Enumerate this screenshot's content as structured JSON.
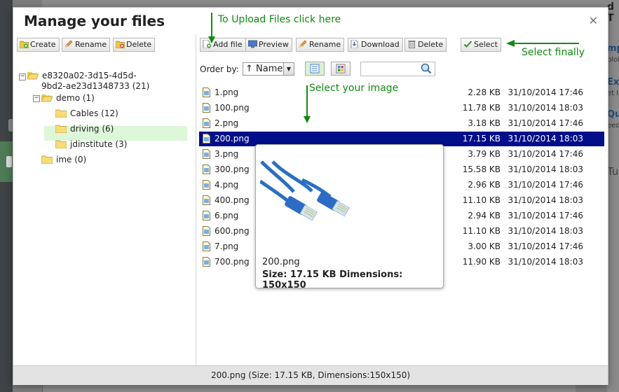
{
  "dialog": {
    "title": "Manage your files"
  },
  "left_toolbar": {
    "create": "Create",
    "rename": "Rename",
    "delete": "Delete"
  },
  "tree": {
    "root": "e8320a02-3d15-4d5d-",
    "root_line2": "9bd2-ae23d1348733 (21)",
    "demo": "demo (1)",
    "cables": "Cables (12)",
    "driving": "driving (6)",
    "jdinstitute": "jdinstitute (3)",
    "ime": "ime (0)"
  },
  "right_toolbar": {
    "add_file": "Add file",
    "preview": "Preview",
    "rename": "Rename",
    "download": "Download",
    "delete": "Delete",
    "select": "Select"
  },
  "order": {
    "label": "Order by:",
    "value": "↑ Name"
  },
  "files": [
    {
      "name": "1.png",
      "size": "2.28 KB",
      "date": "31/10/2014 17:46"
    },
    {
      "name": "100.png",
      "size": "11.78 KB",
      "date": "31/10/2014 18:03"
    },
    {
      "name": "2.png",
      "size": "3.18 KB",
      "date": "31/10/2014 17:46"
    },
    {
      "name": "200.png",
      "size": "17.15 KB",
      "date": "31/10/2014 18:03"
    },
    {
      "name": "3.png",
      "size": "3.79 KB",
      "date": "31/10/2014 17:46"
    },
    {
      "name": "300.png",
      "size": "15.58 KB",
      "date": "31/10/2014 18:03"
    },
    {
      "name": "4.png",
      "size": "2.96 KB",
      "date": "31/10/2014 17:46"
    },
    {
      "name": "400.png",
      "size": "11.10 KB",
      "date": "31/10/2014 18:03"
    },
    {
      "name": "6.png",
      "size": "2.94 KB",
      "date": "31/10/2014 17:46"
    },
    {
      "name": "600.png",
      "size": "11.10 KB",
      "date": "31/10/2014 18:03"
    },
    {
      "name": "7.png",
      "size": "3.00 KB",
      "date": "31/10/2014 17:46"
    },
    {
      "name": "700.png",
      "size": "11.90 KB",
      "date": "31/10/2014 18:03"
    }
  ],
  "preview": {
    "name": "200.png",
    "info": "Size: 17.15 KB Dimensions: 150x150"
  },
  "statusbar": {
    "text": "200.png (Size: 17.15 KB, Dimensions:150x150)"
  },
  "annotations": {
    "upload": "To Upload Files click here",
    "select_image": "Select your image",
    "select_finally": "Select finally"
  },
  "background": {
    "right_t1": "mp",
    "right_s1": "ploi",
    "right_t2": "Exp",
    "right_s2": "et I",
    "right_t3": "Que",
    "right_s3": "eed",
    "right_t4": "Tu",
    "top_right": "d T"
  },
  "colors": {
    "selected_row": "#000e8a",
    "selected_folder": "#dcf8d8",
    "annotation": "#118a11",
    "statusbar": "#e3e3e3"
  }
}
